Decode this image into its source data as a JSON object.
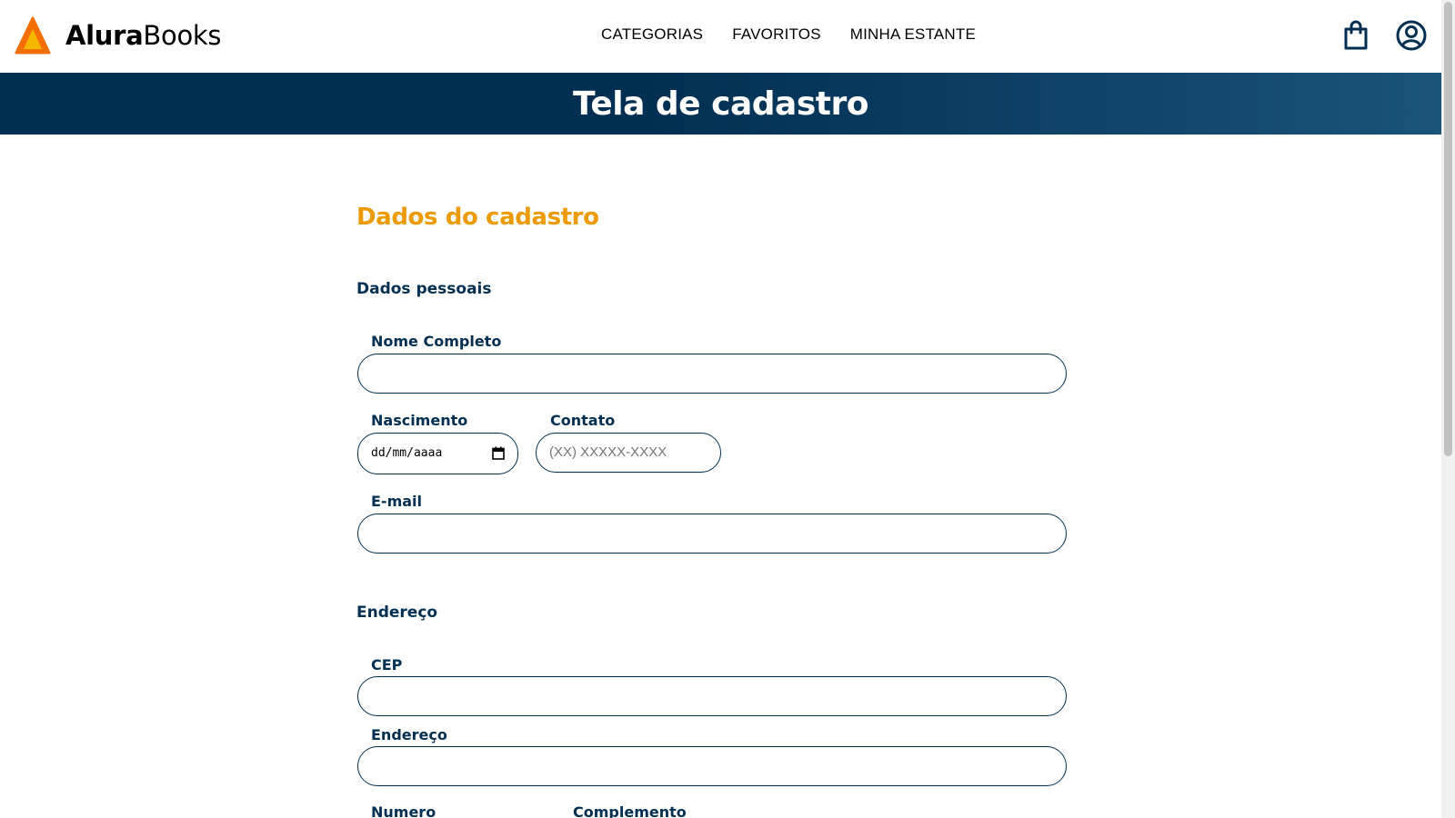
{
  "header": {
    "brand_bold": "Alura",
    "brand_light": "Books",
    "nav": [
      "CATEGORIAS",
      "FAVORITOS",
      "MINHA ESTANTE"
    ],
    "icons": [
      "bag-icon",
      "user-icon"
    ]
  },
  "banner": {
    "title": "Tela de cadastro"
  },
  "form": {
    "title": "Dados do cadastro",
    "personal": {
      "section": "Dados pessoais",
      "name_label": "Nome Completo",
      "birth_label": "Nascimento",
      "birth_value": "dd/mm/aaaa",
      "contact_label": "Contato",
      "contact_placeholder": "(XX) XXXXX-XXXX",
      "email_label": "E-mail"
    },
    "address": {
      "section": "Endereço",
      "cep_label": "CEP",
      "street_label": "Endereço",
      "number_label": "Numero",
      "complement_label": "Complemento"
    }
  },
  "colors": {
    "brand_navy": "#002f52",
    "accent_orange": "#eb9b00",
    "logo_orange": "#f56e00",
    "logo_yellow": "#f5b800"
  }
}
